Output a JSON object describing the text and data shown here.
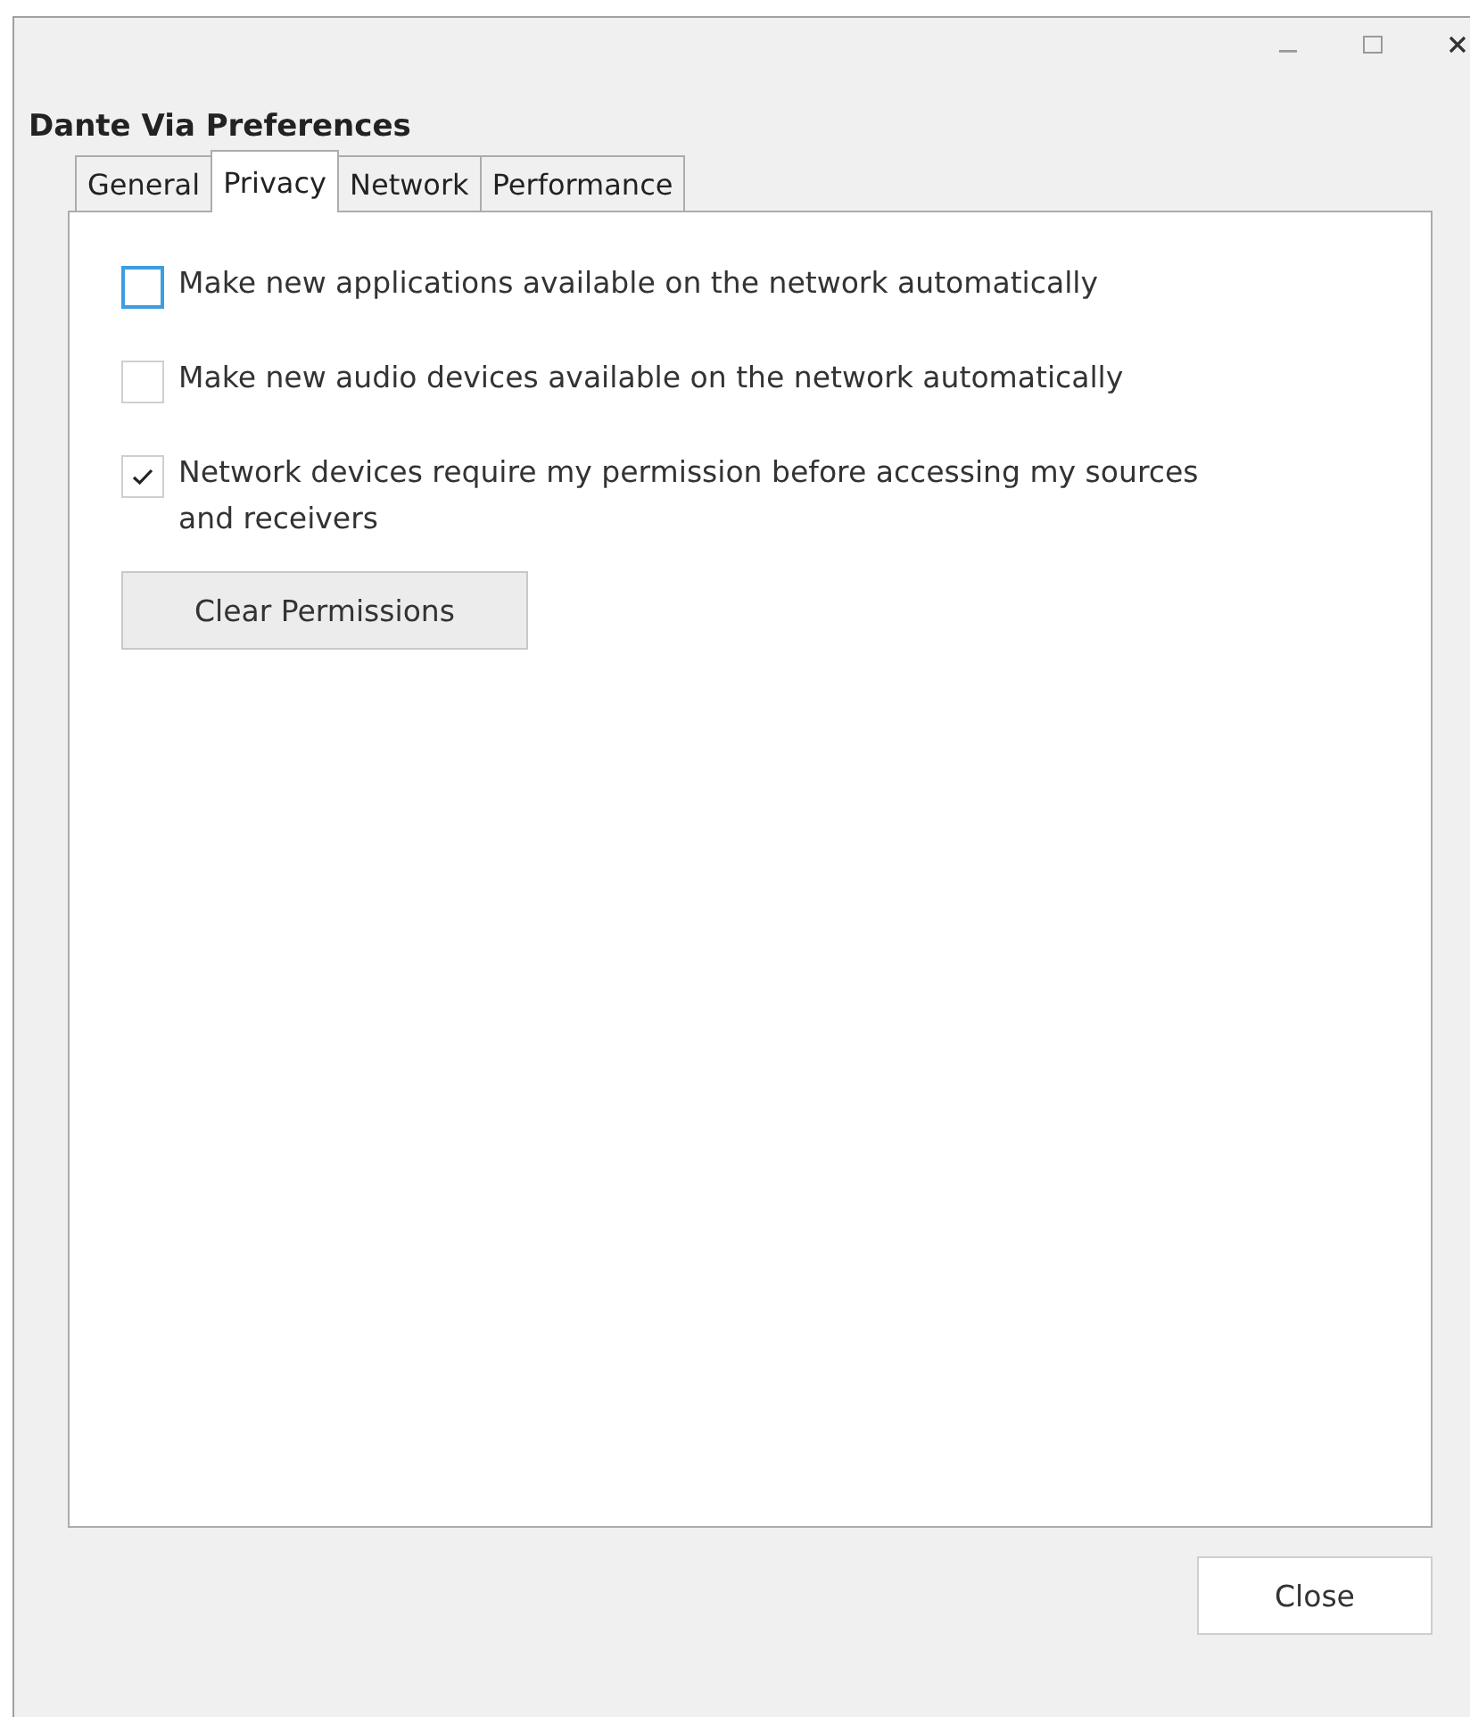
{
  "window": {
    "title": "Dante Via Preferences",
    "controls": [
      {
        "kind": "minimize"
      },
      {
        "kind": "maximize"
      },
      {
        "kind": "close"
      }
    ]
  },
  "tabs": [
    {
      "label": "General",
      "selected": false
    },
    {
      "label": "Privacy",
      "selected": true
    },
    {
      "label": "Network",
      "selected": false
    },
    {
      "label": "Performance",
      "selected": false
    }
  ],
  "options": [
    {
      "kind": "checkbox",
      "label": "Make new applications available on the network automatically",
      "checked": false,
      "focused": true
    },
    {
      "kind": "checkbox",
      "label": "Make new audio devices available on the network automatically",
      "checked": false,
      "focused": false
    },
    {
      "kind": "checkbox",
      "label": "Network devices require my permission before accessing my sources and receivers",
      "checked": true,
      "focused": false
    },
    {
      "kind": "button",
      "label": "Clear Permissions"
    }
  ],
  "buttons": [
    "Close"
  ]
}
